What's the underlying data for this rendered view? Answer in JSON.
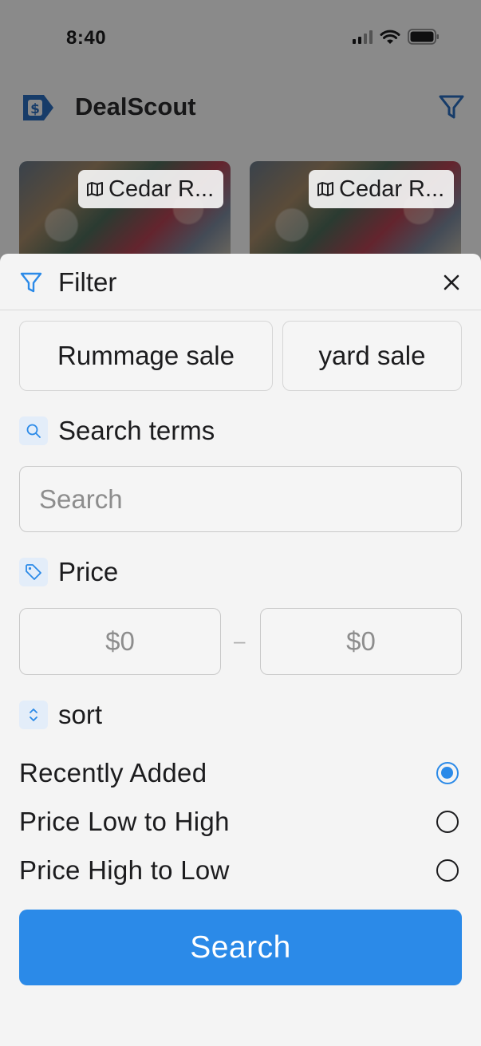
{
  "status_bar": {
    "time": "8:40"
  },
  "app": {
    "title": "DealScout",
    "cards": [
      {
        "location": "Cedar R..."
      },
      {
        "location": "Cedar R..."
      }
    ]
  },
  "sheet": {
    "title": "Filter",
    "categories": [
      {
        "label": "Rummage sale"
      },
      {
        "label": "yard sale"
      }
    ],
    "search_terms": {
      "label": "Search terms",
      "placeholder": "Search",
      "value": ""
    },
    "price": {
      "label": "Price",
      "min_placeholder": "$0",
      "max_placeholder": "$0",
      "separator": "–"
    },
    "sort": {
      "label": "sort",
      "options": [
        {
          "label": "Recently Added",
          "selected": true
        },
        {
          "label": "Price Low to High",
          "selected": false
        },
        {
          "label": "Price High to Low",
          "selected": false
        }
      ]
    },
    "submit_label": "Search"
  },
  "colors": {
    "accent": "#2b8ae8",
    "sheet_background": "#f4f4f4",
    "icon_tint_background": "#e3edf9"
  }
}
